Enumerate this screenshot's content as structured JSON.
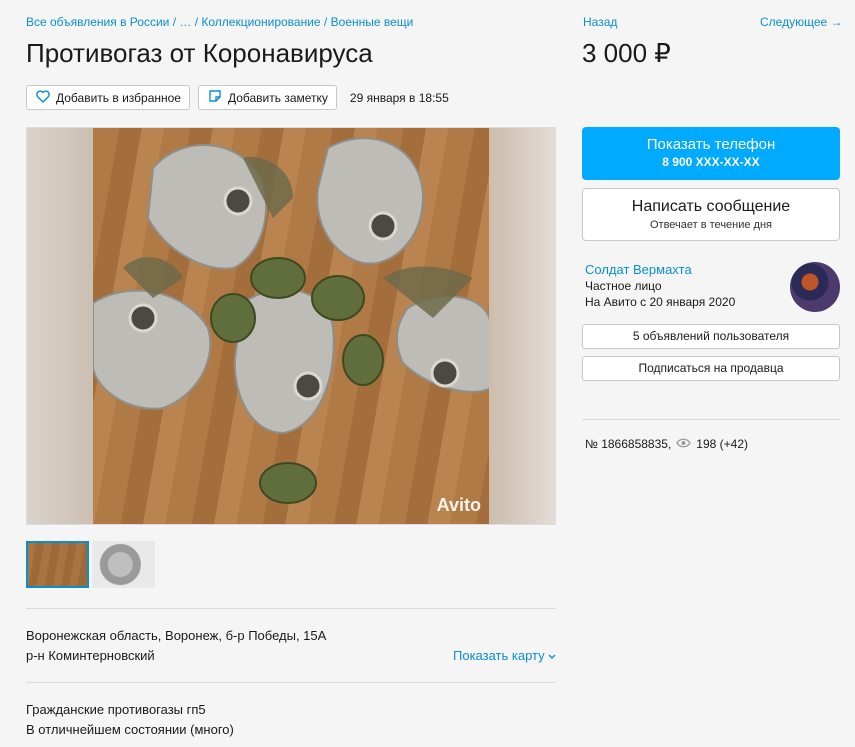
{
  "breadcrumb": {
    "item1": "Все объявления в России",
    "sep1": " / ",
    "item2": "…",
    "sep2": " / ",
    "item3": "Коллекционирование",
    "sep3": " / ",
    "item4": "Военные вещи"
  },
  "title": "Противогаз от Коронавируса",
  "actions": {
    "favorite_label": "Добавить в избранное",
    "note_label": "Добавить заметку",
    "date": "29 января в 18:55"
  },
  "gallery": {
    "watermark": "Avito"
  },
  "location": {
    "address": "Воронежская область, Воронеж, б-р Победы, 15А",
    "district": "р-н Коминтерновский",
    "map_link": "Показать карту"
  },
  "description": {
    "line1": "Гражданские противогазы гп5",
    "line2": "В отличнейшем состоянии (много)"
  },
  "nav": {
    "back": "Назад",
    "next": "Следующее →"
  },
  "price": "3 000 ₽",
  "contact": {
    "phone_label": "Показать телефон",
    "phone_number": "8 900 XXX-XX-XX",
    "message_label": "Написать сообщение",
    "message_sub": "Отвечает в течение дня"
  },
  "seller": {
    "name": "Солдат Вермахта",
    "type": "Частное лицо",
    "since": "На Авито с 20 января 2020",
    "ads_button": "5 объявлений пользователя",
    "subscribe_button": "Подписаться на продавца"
  },
  "meta": {
    "ad_number": "№ 1866858835,",
    "views": "198 (+42)"
  },
  "colors": {
    "accent": "#00aaff",
    "link": "#0a8ed2"
  }
}
